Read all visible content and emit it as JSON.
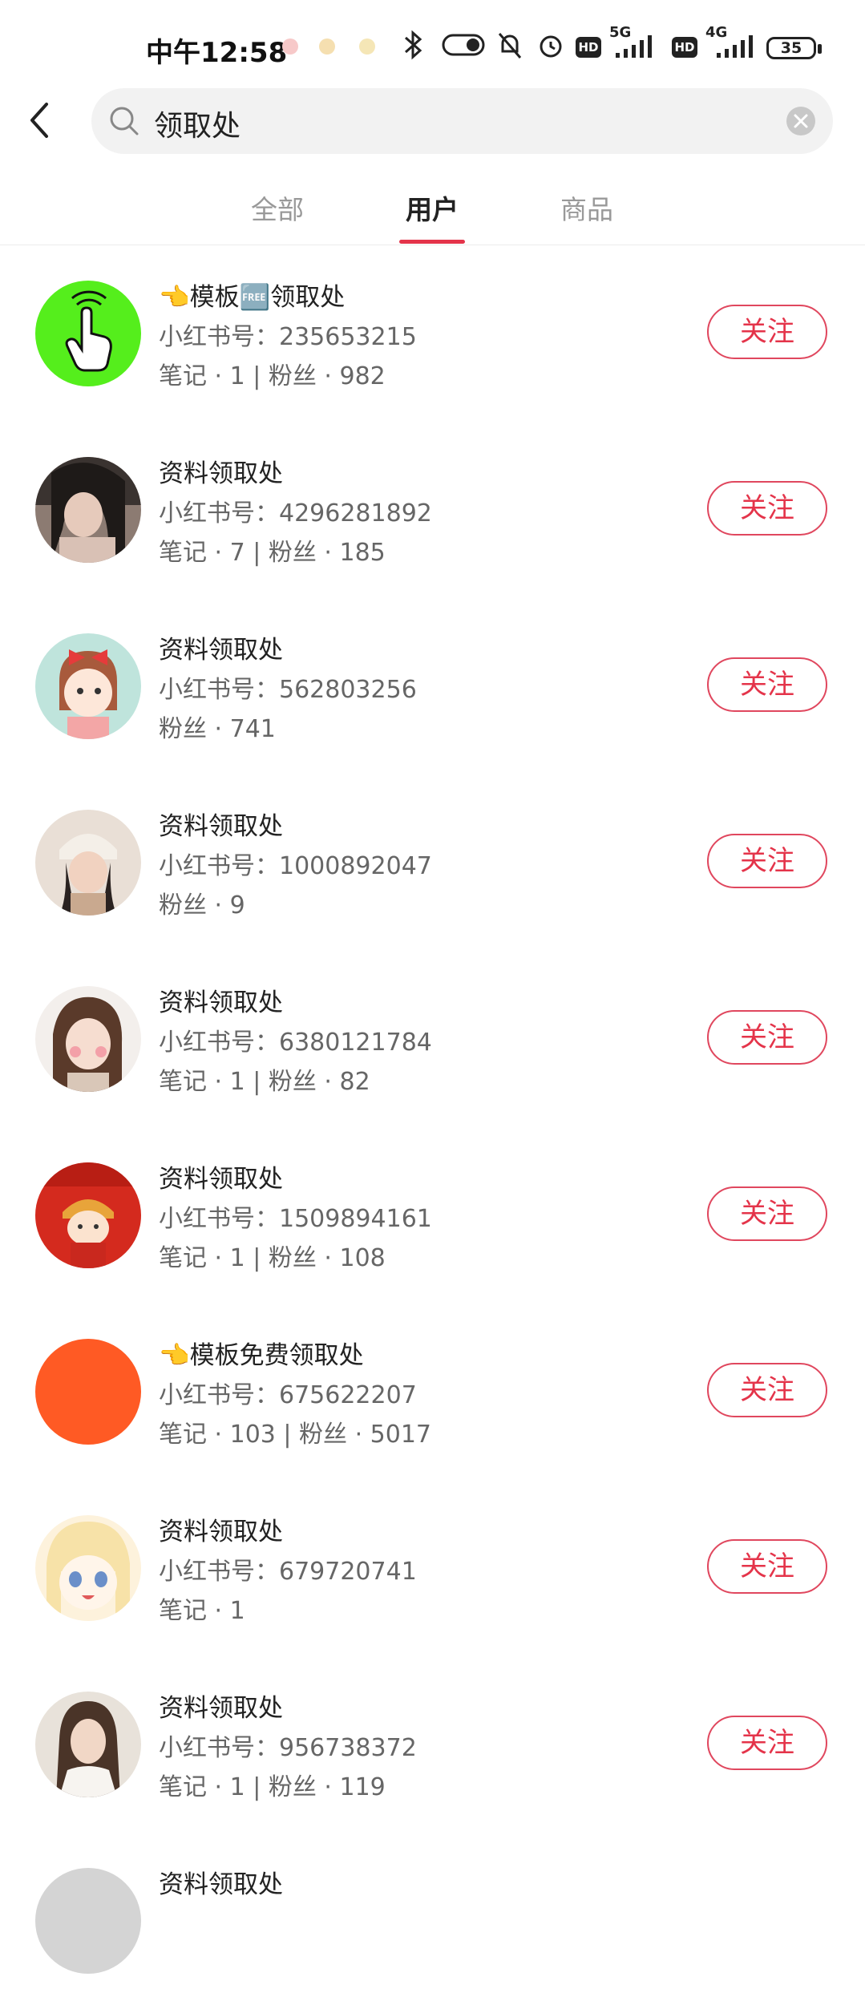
{
  "status_bar": {
    "time": "中午12:58",
    "net1": "5G",
    "net2": "4G",
    "hd": "HD",
    "battery": "35"
  },
  "search": {
    "query": "领取处"
  },
  "tabs": [
    {
      "label": "全部",
      "active": false
    },
    {
      "label": "用户",
      "active": true
    },
    {
      "label": "商品",
      "active": false
    }
  ],
  "follow_label": "关注",
  "users": [
    {
      "name": "👈模板🆓领取处",
      "id_label": "小红书号：",
      "id": "235653215",
      "stats": "笔记 · 1 | 粉丝 · 982",
      "avatar": "green-hand-icon"
    },
    {
      "name": "资料领取处",
      "id_label": "小红书号：",
      "id": "4296281892",
      "stats": "笔记 · 7 | 粉丝 · 185",
      "avatar": "photo-girl"
    },
    {
      "name": "资料领取处",
      "id_label": "小红书号：",
      "id": "562803256",
      "stats": "粉丝 · 741",
      "avatar": "cartoon-girl-bow"
    },
    {
      "name": "资料领取处",
      "id_label": "小红书号：",
      "id": "1000892047",
      "stats": "粉丝 · 9",
      "avatar": "photo-child-hat"
    },
    {
      "name": "资料领取处",
      "id_label": "小红书号：",
      "id": "6380121784",
      "stats": "笔记 · 1 | 粉丝 · 82",
      "avatar": "photo-girl-blush"
    },
    {
      "name": "资料领取处",
      "id_label": "小红书号：",
      "id": "1509894161",
      "stats": "笔记 · 1 | 粉丝 · 108",
      "avatar": "red-new-year-cartoon"
    },
    {
      "name": "👈模板免费领取处",
      "id_label": "小红书号：",
      "id": "675622207",
      "stats": "笔记 · 103 | 粉丝 · 5017",
      "avatar": "orange-circle"
    },
    {
      "name": "资料领取处",
      "id_label": "小红书号：",
      "id": "679720741",
      "stats": "笔记 · 1",
      "avatar": "anime-girl"
    },
    {
      "name": "资料领取处",
      "id_label": "小红书号：",
      "id": "956738372",
      "stats": "笔记 · 1 | 粉丝 · 119",
      "avatar": "photo-girl-white"
    },
    {
      "name": "资料领取处",
      "id_label": "",
      "id": "",
      "stats": "",
      "avatar": "partial-gray"
    }
  ],
  "colors": {
    "accent": "#e4344a",
    "green_avatar": "#55ee1c",
    "orange_avatar": "#ff5a24"
  }
}
